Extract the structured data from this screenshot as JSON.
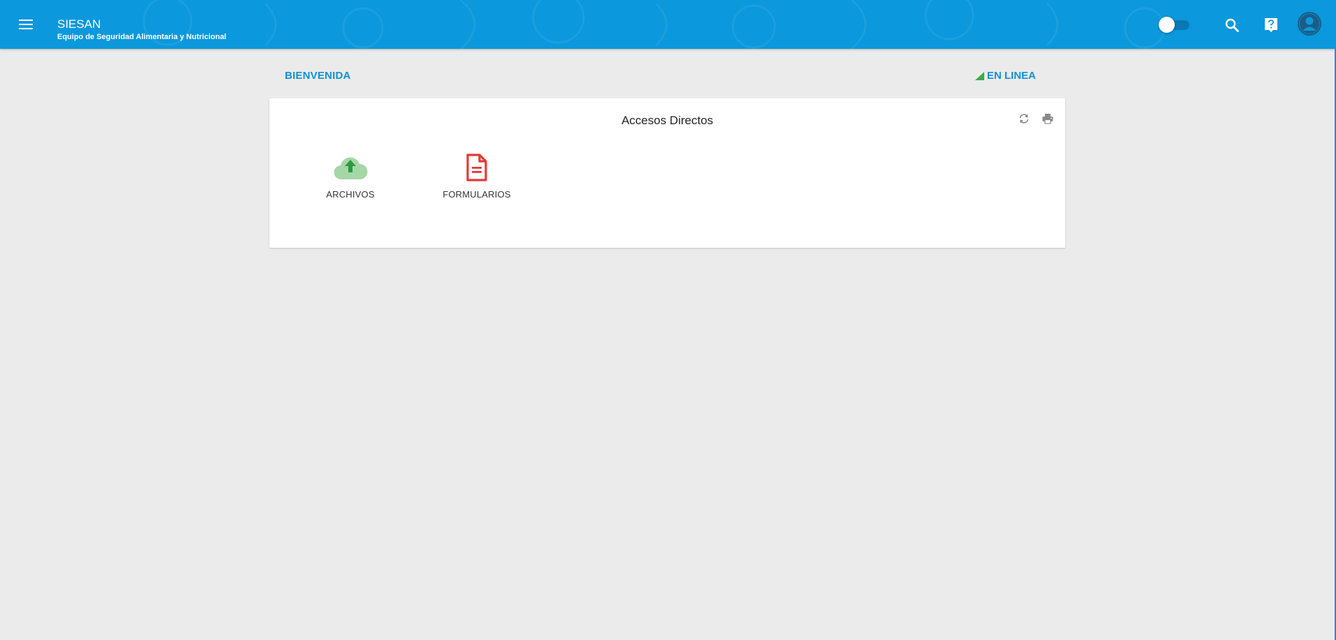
{
  "header": {
    "title": "SIESAN",
    "subtitle": "Equipo de Seguridad Alimentaria y Nutricional",
    "bg_color": "#0b98dc",
    "icons": [
      "menu-icon",
      "theme-toggle",
      "search-icon",
      "help-icon",
      "account-icon"
    ]
  },
  "page": {
    "welcome_label": "BIENVENIDA",
    "status_label": "EN LINEA",
    "status_icon": "signal-icon",
    "status_color": "#3aab4a"
  },
  "card": {
    "title": "Accesos Directos",
    "tools": [
      "refresh-icon",
      "print-icon"
    ],
    "shortcuts": [
      {
        "label": "ARCHIVOS",
        "icon": "cloud-upload-icon",
        "color": "#3aab4a"
      },
      {
        "label": "FORMULARIOS",
        "icon": "document-icon",
        "color": "#e53935"
      }
    ]
  }
}
